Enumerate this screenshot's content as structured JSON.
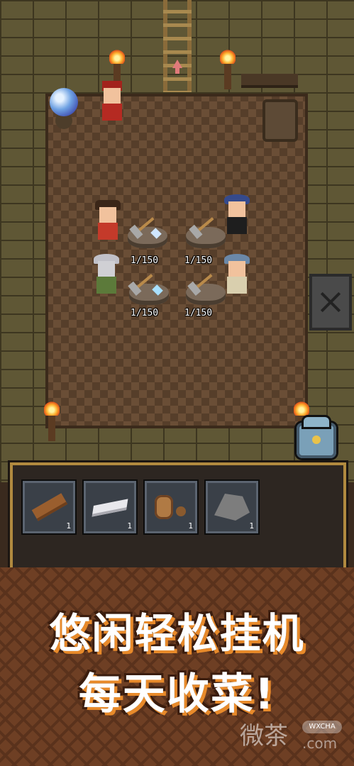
{
  "scene": {
    "workers": [
      {
        "name": "cowboy-worker",
        "counter": "1/150"
      },
      {
        "name": "musketeer-worker",
        "counter": "1/150"
      },
      {
        "name": "knight-worker",
        "counter": "1/150"
      },
      {
        "name": "viking-worker",
        "counter": "1/150"
      }
    ]
  },
  "inventory": {
    "slots": [
      {
        "icon": "wood-log-icon",
        "qty": "1"
      },
      {
        "icon": "silver-ingot-icon",
        "qty": "1"
      },
      {
        "icon": "cookie-icon",
        "qty": "1"
      },
      {
        "icon": "stone-ore-icon",
        "qty": "1"
      }
    ]
  },
  "banner": {
    "line1": "悠闲轻松挂机",
    "line2": "每天收菜!"
  },
  "watermark": {
    "text": "微茶",
    "badge": "WXCHA",
    "sub": ".com"
  }
}
